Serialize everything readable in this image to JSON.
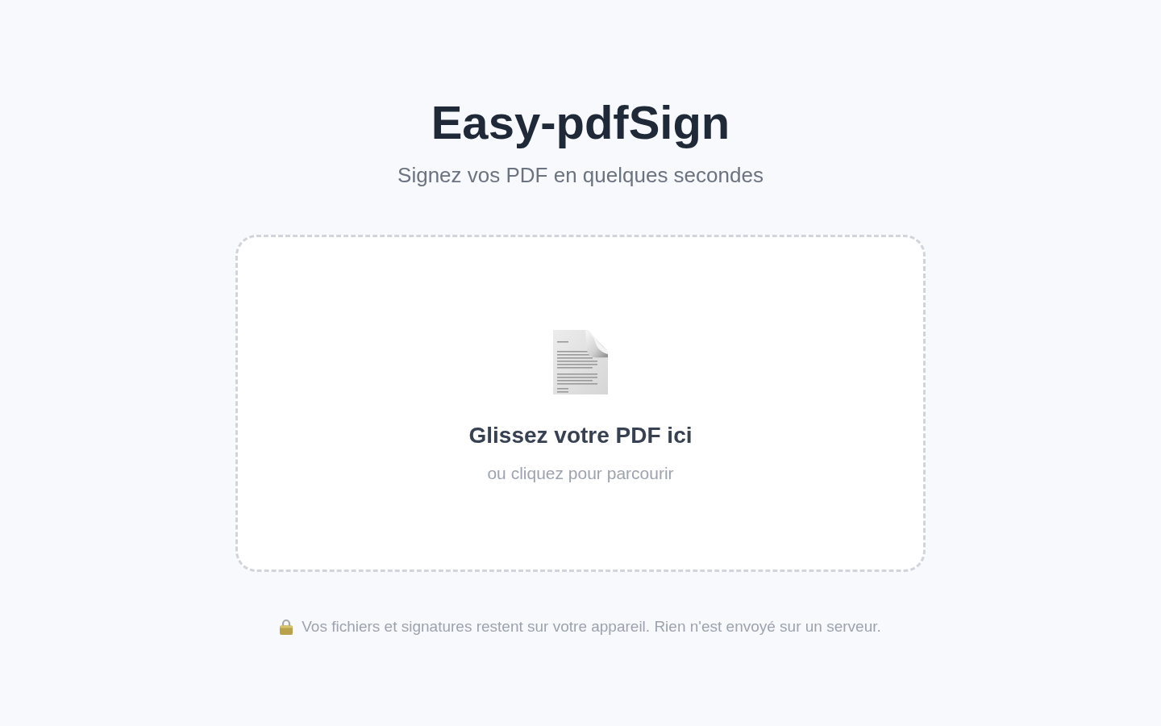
{
  "header": {
    "title": "Easy-pdfSign",
    "subtitle": "Signez vos PDF en quelques secondes"
  },
  "dropzone": {
    "title": "Glissez votre PDF ici",
    "hint": "ou cliquez pour parcourir"
  },
  "footer": {
    "privacy_note": "Vos fichiers et signatures restent sur votre appareil. Rien n'est envoyé sur un serveur."
  }
}
